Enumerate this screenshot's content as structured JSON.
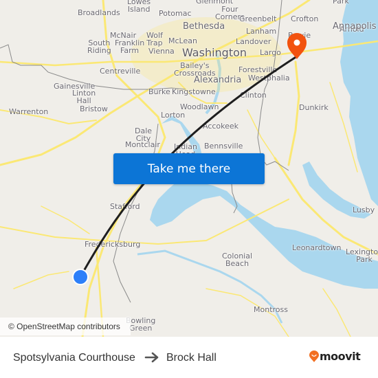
{
  "map": {
    "places": [
      {
        "name": "Lowes Island",
        "label": "Lowes\nIsland"
      },
      {
        "name": "Broadlands",
        "label": "Broadlands"
      },
      {
        "name": "Potomac",
        "label": "Potomac"
      },
      {
        "name": "Glenmont",
        "label": "Glenmont"
      },
      {
        "name": "Four Corners",
        "label": "Four\nCorners"
      },
      {
        "name": "Greenbelt",
        "label": "Greenbelt"
      },
      {
        "name": "Crofton",
        "label": "Crofton"
      },
      {
        "name": "Park",
        "label": "Park"
      },
      {
        "name": "Arnold",
        "label": "Arnold"
      },
      {
        "name": "Annapolis",
        "label": "Annapolis"
      },
      {
        "name": "Bethesda",
        "label": "Bethesda"
      },
      {
        "name": "Lanham",
        "label": "Lanham"
      },
      {
        "name": "McNair",
        "label": "McNair"
      },
      {
        "name": "Wolf Trap",
        "label": "Wolf\nTrap"
      },
      {
        "name": "South Riding",
        "label": "South\nRiding"
      },
      {
        "name": "Franklin Farm",
        "label": "Franklin\nFarm"
      },
      {
        "name": "McLean",
        "label": "McLean"
      },
      {
        "name": "Vienna",
        "label": "Vienna"
      },
      {
        "name": "Landover",
        "label": "Landover"
      },
      {
        "name": "Washington",
        "label": "Washington"
      },
      {
        "name": "Largo",
        "label": "Largo"
      },
      {
        "name": "Bowie",
        "label": "Bowie"
      },
      {
        "name": "Centreville",
        "label": "Centreville"
      },
      {
        "name": "Bailey's Crossroads",
        "label": "Bailey's\nCrossroads"
      },
      {
        "name": "Forestville",
        "label": "Forestville"
      },
      {
        "name": "Westphalia",
        "label": "Westphalia"
      },
      {
        "name": "Alexandria",
        "label": "Alexandria"
      },
      {
        "name": "Gainesville",
        "label": "Gainesville"
      },
      {
        "name": "Linton Hall",
        "label": "Linton\nHall"
      },
      {
        "name": "Burke",
        "label": "Burke"
      },
      {
        "name": "Kingstowne",
        "label": "Kingstowne"
      },
      {
        "name": "Clinton",
        "label": "Clinton"
      },
      {
        "name": "Bristow",
        "label": "Bristow"
      },
      {
        "name": "Warrenton",
        "label": "Warrenton"
      },
      {
        "name": "Lorton",
        "label": "Lorton"
      },
      {
        "name": "Woodlawn",
        "label": "Woodlawn"
      },
      {
        "name": "Dunkirk",
        "label": "Dunkirk"
      },
      {
        "name": "Accokeek",
        "label": "Accokeek"
      },
      {
        "name": "Dale City",
        "label": "Dale\nCity"
      },
      {
        "name": "Montclair",
        "label": "Montclair"
      },
      {
        "name": "Indian Head",
        "label": "Indian\nHead"
      },
      {
        "name": "Bennsville",
        "label": "Bennsville"
      },
      {
        "name": "Stafford",
        "label": "Stafford"
      },
      {
        "name": "Lusby",
        "label": "Lusby"
      },
      {
        "name": "Fredericksburg",
        "label": "Fredericksburg"
      },
      {
        "name": "Leonardtown",
        "label": "Leonardtown"
      },
      {
        "name": "Lexington Park",
        "label": "Lexington\nPark"
      },
      {
        "name": "Colonial Beach",
        "label": "Colonial\nBeach"
      },
      {
        "name": "Montross",
        "label": "Montross"
      },
      {
        "name": "Bowling Green",
        "label": "Bowling\nGreen"
      }
    ],
    "origin_marker": {
      "name": "Spotsylvania Courthouse",
      "color": "#2d7ff9"
    },
    "destination_marker": {
      "name": "Brock Hall",
      "color": "#f2520f"
    },
    "route_color": "#1e1e1e",
    "water_color": "#aad7ee",
    "road_color": "#fbe874",
    "attribution": "© OpenStreetMap contributors"
  },
  "cta_button": {
    "label": "Take me there",
    "color": "#0c75d6"
  },
  "footer": {
    "from": "Spotsylvania Courthouse",
    "to": "Brock Hall",
    "arrow_icon": "arrow-right-icon",
    "brand": "moovit",
    "brand_color": "#f26f21"
  }
}
